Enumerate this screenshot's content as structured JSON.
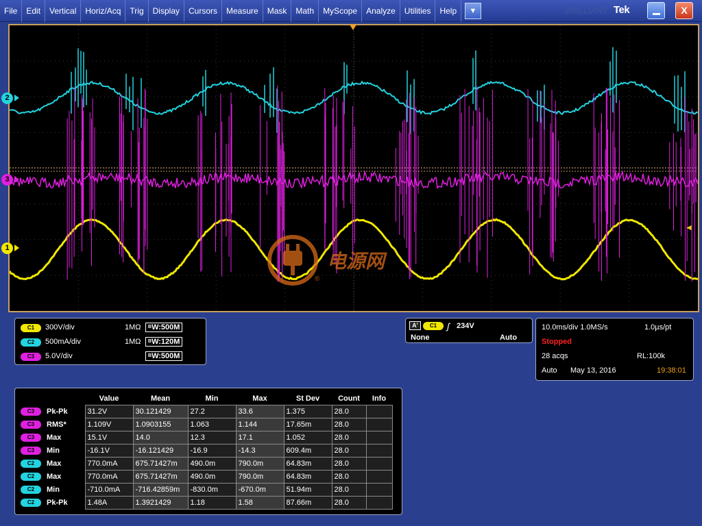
{
  "colors": {
    "ch1": "#f0e800",
    "ch2": "#22d4e0",
    "ch3": "#e020e0",
    "trigger": "#f0a020",
    "stopped": "#ff2020",
    "time": "#f0a020"
  },
  "menu": [
    "File",
    "Edit",
    "Vertical",
    "Horiz/Acq",
    "Trig",
    "Display",
    "Cursors",
    "Measure",
    "Mask",
    "Math",
    "MyScope",
    "Analyze",
    "Utilities",
    "Help"
  ],
  "menu_dropdown_icon": "chevron-down-icon",
  "brand_ghost": "BRILLIANT",
  "brand": "Tek",
  "window_buttons": {
    "minimize_icon": "minimize-icon",
    "close_label": "X"
  },
  "channels": [
    {
      "marker": "2",
      "badge": "C2",
      "scale": "500mA/div",
      "impedance": "1MΩ",
      "bw": "120M"
    },
    {
      "marker": "3",
      "badge": "C3",
      "scale": "5.0V/div",
      "impedance": "",
      "bw": "500M"
    },
    {
      "marker": "1",
      "badge": "C1",
      "scale": "300V/div",
      "impedance": "1MΩ",
      "bw": "500M"
    }
  ],
  "bw_prefix": "B",
  "bw_suffix": "W",
  "trigger_panel": {
    "label": "A'",
    "source": "C1",
    "level": "234V",
    "coupling": "None",
    "mode": "Auto"
  },
  "acq_panel": {
    "timebase": "10.0ms/div 1.0MS/s",
    "resolution": "1.0µs/pt",
    "state": "Stopped",
    "acqs": "28 acqs",
    "record_length": "RL:100k",
    "run_mode": "Auto",
    "date": "May 13, 2016",
    "time": "19:38:01"
  },
  "watermark": {
    "text": "电源网",
    "registered": "®"
  },
  "measurements": {
    "headers": [
      "Value",
      "Mean",
      "Min",
      "Max",
      "St Dev",
      "Count",
      "Info"
    ],
    "rows": [
      {
        "ch": "C3",
        "name": "Pk-Pk",
        "values": [
          "31.2V",
          "30.121429",
          "27.2",
          "33.6",
          "1.375",
          "28.0",
          ""
        ]
      },
      {
        "ch": "C3",
        "name": "RMS*",
        "values": [
          "1.109V",
          "1.0903155",
          "1.063",
          "1.144",
          "17.65m",
          "28.0",
          ""
        ]
      },
      {
        "ch": "C3",
        "name": "Max",
        "values": [
          "15.1V",
          "14.0",
          "12.3",
          "17.1",
          "1.052",
          "28.0",
          ""
        ]
      },
      {
        "ch": "C3",
        "name": "Min",
        "values": [
          "-16.1V",
          "-16.121429",
          "-16.9",
          "-14.3",
          "609.4m",
          "28.0",
          ""
        ]
      },
      {
        "ch": "C2",
        "name": "Max",
        "values": [
          "770.0mA",
          "675.71427m",
          "490.0m",
          "790.0m",
          "64.83m",
          "28.0",
          ""
        ]
      },
      {
        "ch": "C2",
        "name": "Max",
        "values": [
          "770.0mA",
          "675.71427m",
          "490.0m",
          "790.0m",
          "64.83m",
          "28.0",
          ""
        ]
      },
      {
        "ch": "C2",
        "name": "Min",
        "values": [
          "-710.0mA",
          "-716.42859m",
          "-830.0m",
          "-670.0m",
          "51.94m",
          "28.0",
          ""
        ]
      },
      {
        "ch": "C2",
        "name": "Pk-Pk",
        "values": [
          "1.48A",
          "1.3921429",
          "1.18",
          "1.58",
          "87.66m",
          "28.0",
          ""
        ]
      }
    ]
  }
}
